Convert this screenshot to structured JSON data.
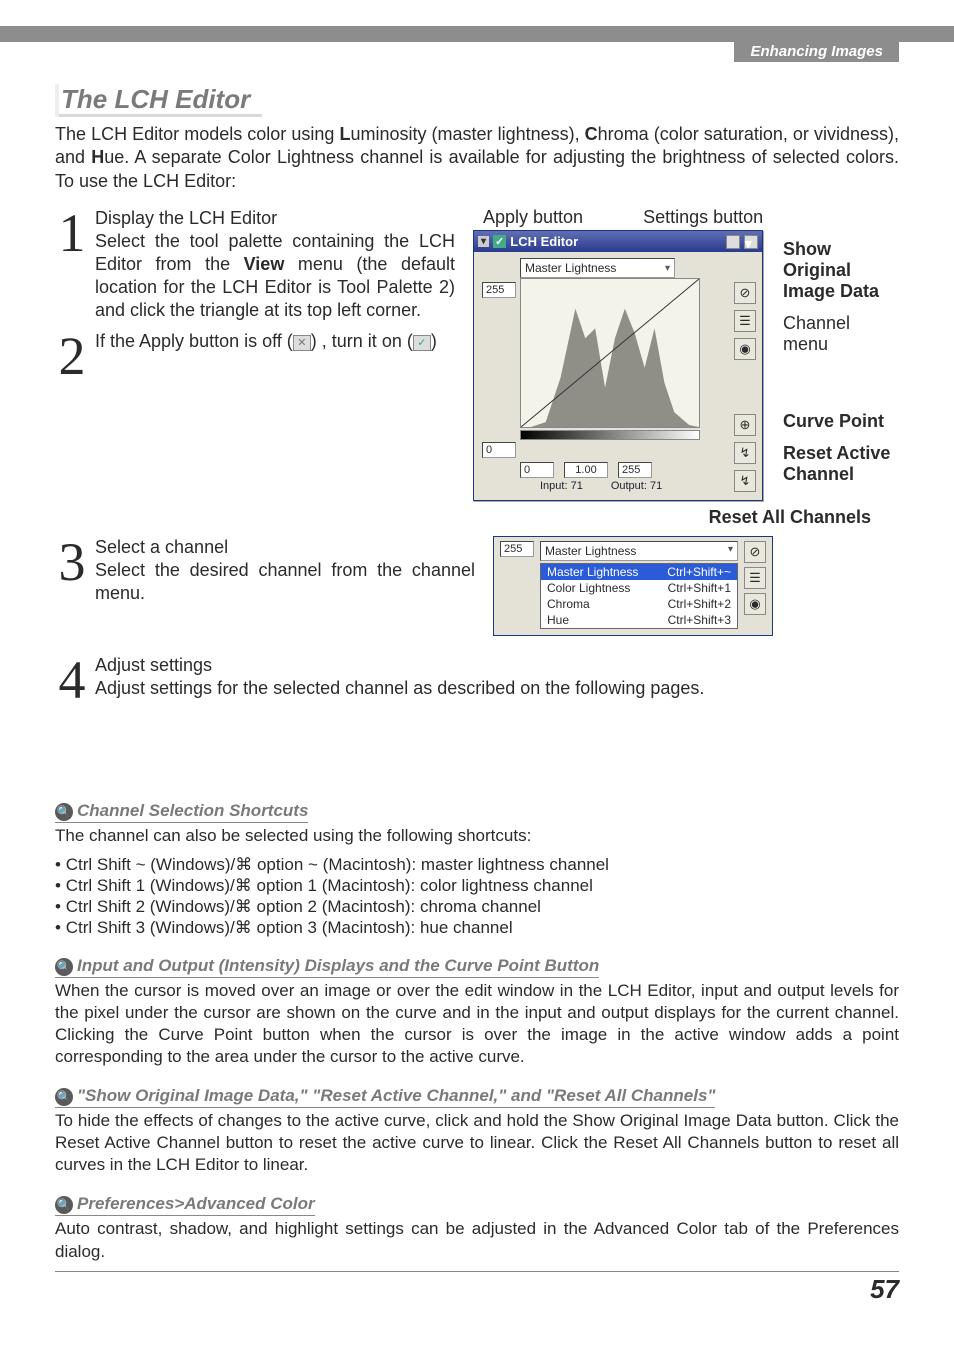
{
  "eyebrow": "Enhancing Images",
  "title": "The LCH Editor",
  "intro_parts": {
    "a": "The LCH Editor models color using ",
    "L": "L",
    "b": "uminosity (master lightness), ",
    "C": "C",
    "c": "hroma (color saturation, or vividness), and ",
    "H": "H",
    "d": "ue.  A separate Color Lightness channel is available for adjusting the bright­ness of selected colors.  To use the LCH Editor:"
  },
  "steps": {
    "s1": {
      "num": "1",
      "heading": "Display the LCH Editor",
      "body_a": "Select the tool palette containing the LCH Editor from the ",
      "menu": "View",
      "body_b": " menu (the default location for the LCH Editor is Tool Palette 2) and click the triangle at its top left corner."
    },
    "s2": {
      "num": "2",
      "heading_a": "If the Apply button is off (",
      "heading_b": ") , turn it on (",
      "heading_c": ")"
    },
    "s3": {
      "num": "3",
      "heading": "Select a channel",
      "body": "Select the desired channel from the chan­nel menu."
    },
    "s4": {
      "num": "4",
      "heading": "Adjust settings",
      "body": "Adjust settings for the selected channel as described on the following pages."
    }
  },
  "fig": {
    "apply_label": "Apply button",
    "settings_label": "Settings button",
    "panel_title": "LCH Editor",
    "channel_select": "Master Lightness",
    "top_value": "255",
    "bottom_value": "0",
    "footer_min": "0",
    "footer_mid": "1.00",
    "footer_max": "255",
    "input_label": "Input: 71",
    "output_label": "Output: 71",
    "callout_show": "Show Original Image Data",
    "callout_menu": "Channel menu",
    "callout_curve": "Curve Point",
    "callout_reset_active": "Reset Active Channel",
    "reset_all": "Reset All Channels"
  },
  "dropdown": {
    "selected": "Master Lightness",
    "left_val": "255",
    "items": [
      {
        "label": "Master Lightness",
        "shortcut": "Ctrl+Shift+~",
        "sel": true
      },
      {
        "label": "Color Lightness",
        "shortcut": "Ctrl+Shift+1",
        "sel": false
      },
      {
        "label": "Chroma",
        "shortcut": "Ctrl+Shift+2",
        "sel": false
      },
      {
        "label": "Hue",
        "shortcut": "Ctrl+Shift+3",
        "sel": false
      }
    ]
  },
  "notes": {
    "n1": {
      "title": "Channel Selection Shortcuts",
      "lead": "The channel can also be selected using the following shortcuts:",
      "items": [
        "Ctrl Shift ~ (Windows)/⌘ option ~ (Macintosh): master lightness channel",
        "Ctrl Shift 1 (Windows)/⌘ option 1 (Macintosh): color lightness channel",
        "Ctrl Shift 2 (Windows)/⌘ option 2 (Macintosh): chroma channel",
        "Ctrl Shift 3 (Windows)/⌘ option 3 (Macintosh): hue channel"
      ]
    },
    "n2": {
      "title": "Input and Output (Intensity) Displays and the Curve Point Button",
      "body": "When the cursor is moved over an image or over the edit window in the LCH Editor, input and output levels for the pixel under the cursor are shown on the curve and in the input and output displays for the current channel.  Clicking the Curve Point button when the cursor is over the image in the active window adds a point corresponding to the area under the cursor to the active curve."
    },
    "n3": {
      "title": "\"Show Original Image Data,\" \"Reset Active Channel,\" and \"Reset All Channels\"",
      "body": "To hide the effects of changes to the active curve, click and hold the Show Original Image Data button.  Click the Reset Active Channel button to reset the active curve to linear.  Click the Reset All Channels button to reset all curves in the LCH Editor to linear."
    },
    "n4": {
      "title": "Preferences>Advanced Color",
      "body": "Auto contrast, shadow, and highlight settings can be adjusted in the Advanced Color tab of the Prefer­ences dialog."
    }
  },
  "page_number": "57"
}
